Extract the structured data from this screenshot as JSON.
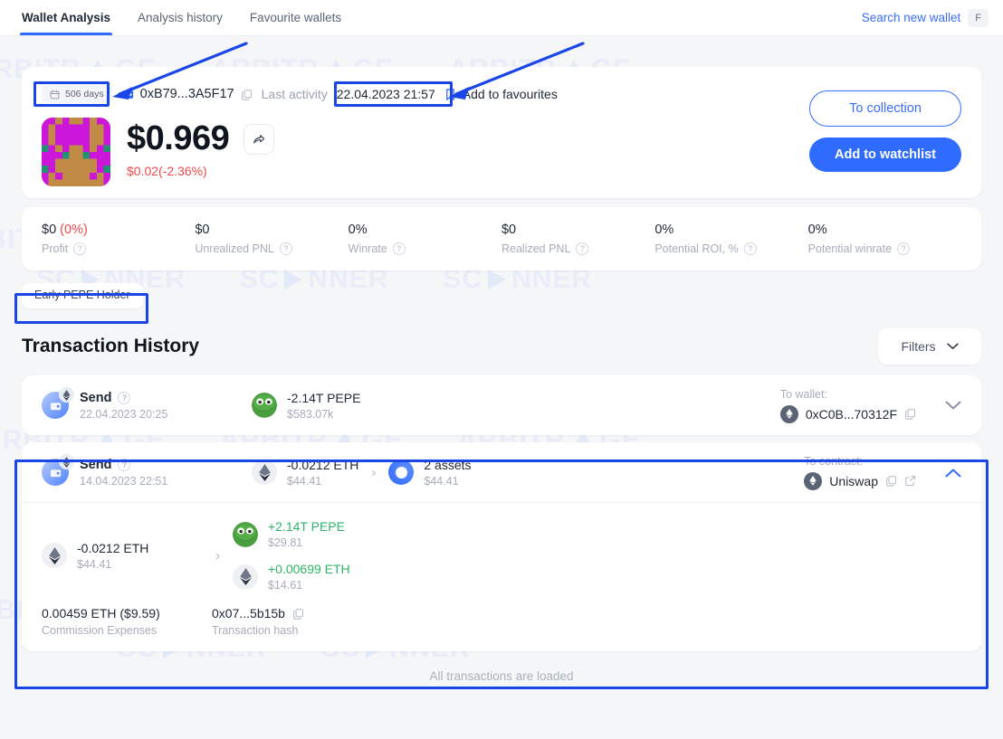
{
  "nav": {
    "tabs": [
      {
        "label": "Wallet Analysis",
        "active": true
      },
      {
        "label": "Analysis history",
        "active": false
      },
      {
        "label": "Favourite wallets",
        "active": false
      }
    ],
    "search_label": "Search new wallet",
    "search_shortcut": "F"
  },
  "summary": {
    "days_chip": "506 days",
    "address": "0xB79...3A5F17",
    "last_activity_label": "Last activity",
    "last_activity_value": "22.04.2023 21:57",
    "favourites_label": "Add to favourites",
    "price": "$0.969",
    "delta": "$0.02(-2.36%)",
    "delta_color": "#f0484a",
    "to_collection": "To collection",
    "add_to_watchlist": "Add to watchlist",
    "accent": "#2f6bff"
  },
  "stats": [
    {
      "value": "$0",
      "paren": " (0%)",
      "label": "Profit"
    },
    {
      "value": "$0",
      "paren": "",
      "label": "Unrealized PNL"
    },
    {
      "value": "0%",
      "paren": "",
      "label": "Winrate"
    },
    {
      "value": "$0",
      "paren": "",
      "label": "Realized PNL"
    },
    {
      "value": "0%",
      "paren": "",
      "label": "Potential ROI, %"
    },
    {
      "value": "0%",
      "paren": "",
      "label": "Potential winrate"
    }
  ],
  "tag": "Early PEPE Holder",
  "history": {
    "title": "Transaction History",
    "filters_label": "Filters",
    "all_loaded": "All transactions are loaded"
  },
  "tx1": {
    "type": "Send",
    "date": "22.04.2023 20:25",
    "asset_amount": "-2.14T PEPE",
    "asset_value": "$583.07k",
    "to_label": "To wallet:",
    "to_value": "0xC0B...70312F"
  },
  "tx2": {
    "type": "Send",
    "date": "14.04.2023 22:51",
    "from_amount": "-0.0212 ETH",
    "from_value": "$44.41",
    "to_amount": "2 assets",
    "to_value_usd": "$44.41",
    "to_label": "To contract:",
    "contract": "Uniswap",
    "detail": {
      "out_amount": "-0.0212 ETH",
      "out_value": "$44.41",
      "in_items": [
        {
          "amount": "+2.14T PEPE",
          "value": "$29.81",
          "coin": "pepe-icon"
        },
        {
          "amount": "+0.00699 ETH",
          "value": "$14.61",
          "coin": "eth-icon"
        }
      ],
      "commission_value": "0.00459 ETH ($9.59)",
      "commission_label": "Commission Expenses",
      "hash_value": "0x07...5b15b",
      "hash_label": "Transaction hash"
    }
  },
  "watermark": {
    "word_a": "ARBITR",
    "word_a_tail": "GE",
    "word_b": "SC",
    "word_b_tail": "NNER"
  }
}
